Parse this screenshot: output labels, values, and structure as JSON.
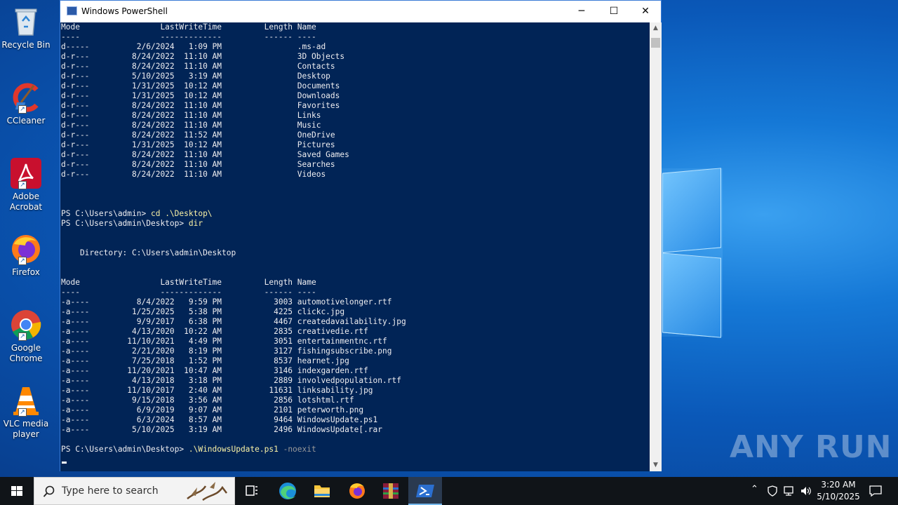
{
  "desktop_icons": [
    {
      "label": "Recycle Bin"
    },
    {
      "label": "CCleaner"
    },
    {
      "label": "Adobe Acrobat"
    },
    {
      "label": "Firefox"
    },
    {
      "label": "Google Chrome"
    },
    {
      "label": "VLC media player"
    }
  ],
  "window": {
    "title": "Windows PowerShell",
    "minimize_symbol": "─",
    "maximize_symbol": "☐",
    "close_symbol": "✕"
  },
  "console": {
    "lines": [
      "Mode                 LastWriteTime         Length Name",
      "----                 -------------         ------ ----",
      "d-----          2/6/2024   1:09 PM                .ms-ad",
      "d-r---         8/24/2022  11:10 AM                3D Objects",
      "d-r---         8/24/2022  11:10 AM                Contacts",
      "d-r---         5/10/2025   3:19 AM                Desktop",
      "d-r---         1/31/2025  10:12 AM                Documents",
      "d-r---         1/31/2025  10:12 AM                Downloads",
      "d-r---         8/24/2022  11:10 AM                Favorites",
      "d-r---         8/24/2022  11:10 AM                Links",
      "d-r---         8/24/2022  11:10 AM                Music",
      "d-r---         8/24/2022  11:52 AM                OneDrive",
      "d-r---         1/31/2025  10:12 AM                Pictures",
      "d-r---         8/24/2022  11:10 AM                Saved Games",
      "d-r---         8/24/2022  11:10 AM                Searches",
      "d-r---         8/24/2022  11:10 AM                Videos",
      "",
      "",
      ""
    ],
    "prompt1": "PS C:\\Users\\admin> ",
    "cmd1": "cd .\\Desktop\\",
    "prompt2": "PS C:\\Users\\admin\\Desktop> ",
    "cmd2": "dir",
    "directory_line": "    Directory: C:\\Users\\admin\\Desktop",
    "lines2": [
      "Mode                 LastWriteTime         Length Name",
      "----                 -------------         ------ ----",
      "-a----          8/4/2022   9:59 PM           3003 automotivelonger.rtf",
      "-a----         1/25/2025   5:38 PM           4225 clickc.jpg",
      "-a----          9/9/2017   6:38 PM           4467 createdavailability.jpg",
      "-a----         4/13/2020  10:22 AM           2835 creativedie.rtf",
      "-a----        11/10/2021   4:49 PM           3051 entertainmentnc.rtf",
      "-a----         2/21/2020   8:19 PM           3127 fishingsubscribe.png",
      "-a----         7/25/2018   1:52 PM           8537 hearnet.jpg",
      "-a----        11/20/2021  10:47 AM           3146 indexgarden.rtf",
      "-a----         4/13/2018   3:18 PM           2889 involvedpopulation.rtf",
      "-a----        11/10/2017   2:40 AM          11631 linksability.jpg",
      "-a----         9/15/2018   3:56 AM           2856 lotshtml.rtf",
      "-a----          6/9/2019   9:07 AM           2101 peterworth.png",
      "-a----          6/3/2024   8:57 AM           9464 WindowsUpdate.ps1",
      "-a----         5/10/2025   3:19 AM           2496 WindowsUpdate[.rar"
    ],
    "prompt3": "PS C:\\Users\\admin\\Desktop> ",
    "cmd3": ".\\WindowsUpdate.ps1",
    "cmd3_arg": " -noexit"
  },
  "watermark": "ANY RUN",
  "taskbar": {
    "search_placeholder": "Type here to search",
    "time": "3:20 AM",
    "date": "5/10/2025"
  }
}
